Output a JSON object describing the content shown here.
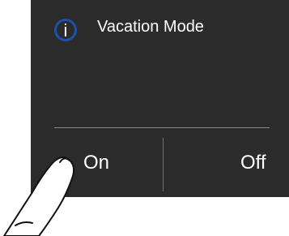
{
  "dialog": {
    "title": "Vacation Mode",
    "info_icon_glyph": "i",
    "icon": "info-icon",
    "buttons": {
      "on_label": "On",
      "off_label": "Off"
    }
  },
  "overlay": {
    "icon": "pointing-hand-icon"
  },
  "colors": {
    "dialog_background": "#2b2b2b",
    "text": "#ffffff",
    "info_ring": "#1f4fa8",
    "divider": "#8a8a8a"
  }
}
